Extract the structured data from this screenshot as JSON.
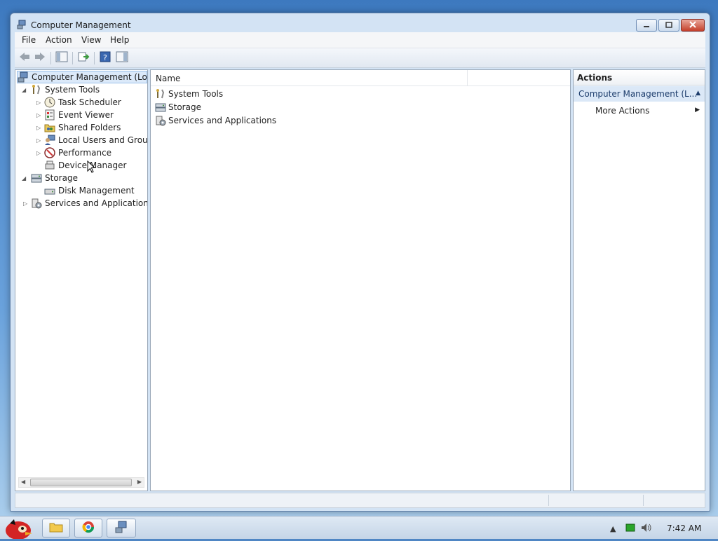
{
  "window": {
    "title": "Computer Management"
  },
  "menu": {
    "file": "File",
    "action": "Action",
    "view": "View",
    "help": "Help"
  },
  "toolbar": {
    "buttons": [
      "back-icon",
      "forward-icon",
      "show-hide-tree-icon",
      "export-list-icon",
      "help-icon",
      "show-hide-action-pane-icon"
    ]
  },
  "tree": {
    "root": "Computer Management (Local",
    "system_tools": "System Tools",
    "task_scheduler": "Task Scheduler",
    "event_viewer": "Event Viewer",
    "shared_folders": "Shared Folders",
    "local_users": "Local Users and Groups",
    "performance": "Performance",
    "device_manager": "Device Manager",
    "storage": "Storage",
    "disk_management": "Disk Management",
    "services": "Services and Applications"
  },
  "list": {
    "column_name": "Name",
    "items": [
      "System Tools",
      "Storage",
      "Services and Applications"
    ]
  },
  "actions": {
    "header": "Actions",
    "section": "Computer Management (L...",
    "more": "More Actions"
  },
  "taskbar": {
    "clock": "7:42 AM"
  },
  "colors": {
    "selection": "#dbe9f9",
    "actions_section": "#dbe8f7",
    "window_frame": "#d3e3f4"
  }
}
